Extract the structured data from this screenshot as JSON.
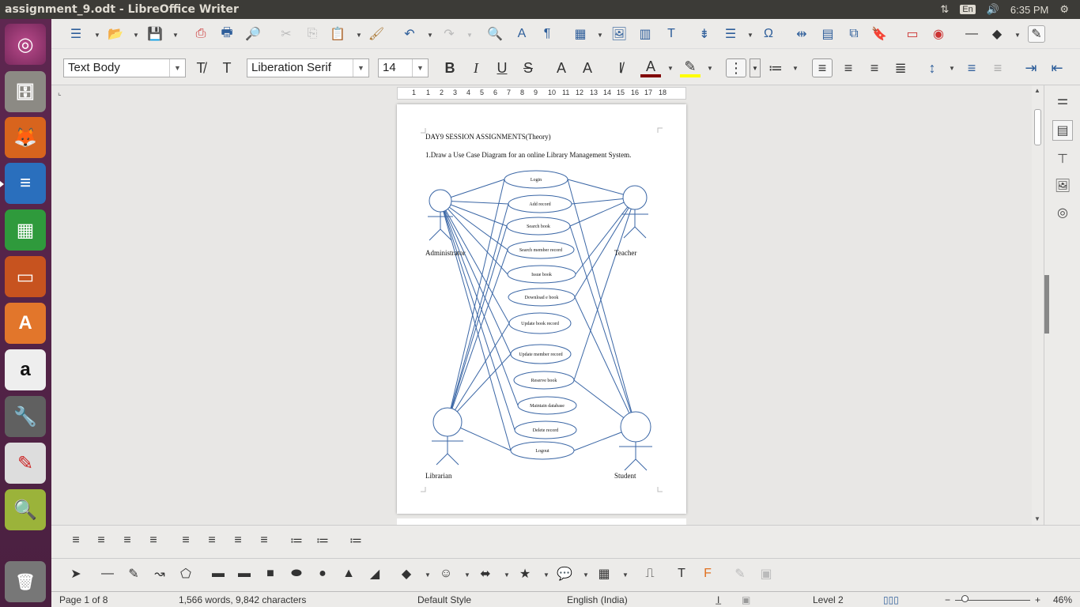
{
  "window": {
    "title": "assignment_9.odt - LibreOffice Writer",
    "keyboard": "En",
    "time": "6:35 PM"
  },
  "formatting": {
    "style": "Text Body",
    "font": "Liberation Serif",
    "size": "14"
  },
  "document": {
    "heading": "DAY9 SESSION ASSIGNMENTS(Theory)",
    "question": "1.Draw a Use Case Diagram for an online Library Management System.",
    "actors": [
      "Administrator",
      "Teacher",
      "Librarian",
      "Student"
    ],
    "use_cases": [
      "Login",
      "Add record",
      "Search book",
      "Search member record",
      "Issue book",
      "Download e book",
      "Update book record",
      "Update member record",
      "Reserve book",
      "Maintain database",
      "Delete record",
      "Logout"
    ]
  },
  "ruler_numbers": [
    "1",
    "1",
    "2",
    "3",
    "4",
    "5",
    "6",
    "7",
    "8",
    "9",
    "10",
    "11",
    "12",
    "13",
    "14",
    "15",
    "16",
    "17",
    "18"
  ],
  "status": {
    "page": "Page 1 of 8",
    "words": "1,566 words, 9,842 characters",
    "page_style": "Default Style",
    "language": "English (India)",
    "level": "Level 2",
    "zoom": "46%"
  },
  "colors": {
    "diagram_stroke": "#3a66a5",
    "launcher": "#5e2750",
    "accent": "#2e5e9a"
  }
}
